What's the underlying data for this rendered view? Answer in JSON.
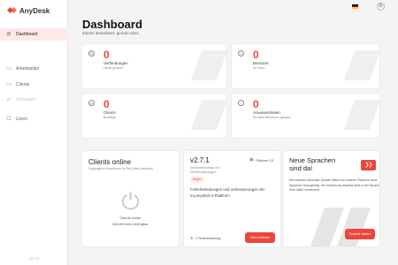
{
  "app": {
    "name": "AnyDesk",
    "version": "v2.7.1",
    "brand_color": "#ef443b"
  },
  "sidebar": {
    "items": [
      {
        "label": "Dashboard",
        "icon": "dashboard-icon",
        "active": true
      },
      {
        "label": "Arbeitsplatz",
        "icon": "desk-icon"
      },
      {
        "label": "Clients",
        "icon": "monitor-icon"
      },
      {
        "label": "Sitzungen",
        "icon": "sessions-icon",
        "disabled": true
      },
      {
        "label": "Users",
        "icon": "user-icon"
      }
    ]
  },
  "header": {
    "title": "Dashboard",
    "subtitle": "Zuletzt aktualisiert: gerade eben",
    "flag": "german-flag-icon",
    "settings_icon": "settings-icon"
  },
  "stats": [
    {
      "value": "0",
      "label": "Verbindungen",
      "sub": "Heute gesamt",
      "icon": "connection-icon"
    },
    {
      "value": "0",
      "label": "Benutzer",
      "sub": "Im Team",
      "icon": "user-icon"
    },
    {
      "value": "0",
      "label": "Clients",
      "sub": "Bestätigt",
      "icon": "client-icon"
    },
    {
      "value": "0",
      "label": "Anwesenheiten",
      "sub": "Mit allen Benutzern gesamt",
      "icon": "presence-icon"
    }
  ],
  "clients_card": {
    "title": "Clients online",
    "subtitle": "Zugängliche Maschinen für Sie (Web-Interface)",
    "line1": "Clients online",
    "line2": "Derzeit nicht verfügbar",
    "icon": "plug-icon"
  },
  "version_card": {
    "title": "v2.7.1",
    "sub1": "Versionshinweise um",
    "sub2": "Veröffentlichungen",
    "date": "Oktober 13",
    "badge": "Bugfix",
    "desc1": "Fehlerbehebungen und Verbesserungen der",
    "desc2": "my.anydesk II-Plattform",
    "footer": "1 Fehlerbehebung",
    "button": "Mehr erfahren"
  },
  "news_card": {
    "title1": "Neue Sprachen",
    "title2": "sind da!",
    "desc": "Mit unserem neuesten Update haben wir unserer Plattform neue Sprachen hinzugefügt. Sie können my.anydesk jetzt in der Sprache Ihrer Wahl verwenden.",
    "button": "Sprache wählen"
  }
}
